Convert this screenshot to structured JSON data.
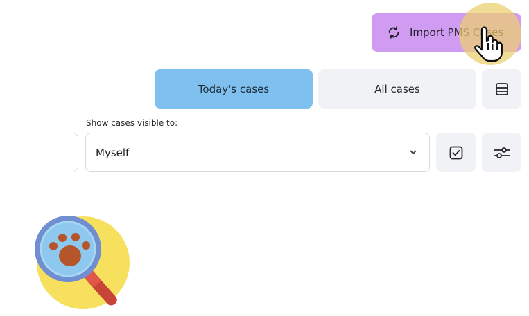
{
  "header": {
    "import_button_label": "Import PMS Cases"
  },
  "tabs": [
    {
      "label": "Today's cases",
      "active": true
    },
    {
      "label": "All cases",
      "active": false
    }
  ],
  "filter": {
    "visibility_caption": "Show cases visible to:",
    "visibility_value": "Myself",
    "search_value": ""
  },
  "icons": {
    "import": "sync-icon",
    "list_view": "list-view-icon",
    "select": "checkbox-icon",
    "filters": "sliders-icon",
    "dropdown": "chevron-down-icon",
    "empty_state": "paw-magnifier-illustration"
  },
  "colors": {
    "import_button": "#cf9cf2",
    "active_tab": "#7fc0ef",
    "inactive_tab": "#f1f2f6",
    "cursor_highlight": "#eece6e",
    "illustration_circle": "#f6e05e",
    "magnifier_lens": "#8fc8ee",
    "magnifier_rim": "#6f8fd1",
    "paw": "#b4552c"
  }
}
